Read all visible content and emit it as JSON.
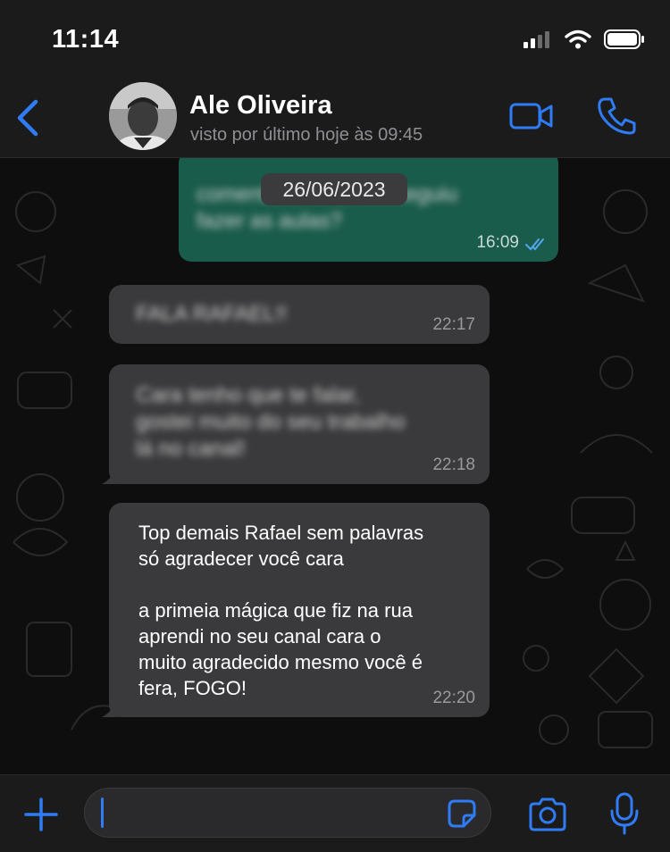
{
  "status_bar": {
    "time": "11:14"
  },
  "header": {
    "contact_name": "Ale Oliveira",
    "last_seen": "visto por último hoje às 09:45",
    "icons": [
      "chevron-left-icon",
      "video-call-icon",
      "phone-call-icon"
    ]
  },
  "chat": {
    "date_label": "26/06/2023",
    "messages": [
      {
        "direction": "outgoing",
        "text_blurred": true,
        "time": "16:09",
        "read": true
      },
      {
        "direction": "incoming",
        "text_blurred": true,
        "time": "22:17"
      },
      {
        "direction": "incoming",
        "text_blurred": true,
        "time": "22:18"
      },
      {
        "direction": "incoming",
        "text": "Top demais Rafael sem palavras\nsó agradecer você cara\n\na primeia mágica que fiz na rua\naprendi no seu canal cara o\nmuito agradecido mesmo você é\nfera, FOGO!",
        "time": "22:20"
      }
    ]
  },
  "composer": {
    "input_value": "",
    "icons": [
      "plus-icon",
      "sticker-icon",
      "camera-icon",
      "microphone-icon"
    ]
  },
  "colors": {
    "accent": "#2f7cf6",
    "incoming_bubble": "#3a3a3c",
    "outgoing_bubble": "#1a5c4b",
    "bar_background": "#1b1b1b"
  }
}
